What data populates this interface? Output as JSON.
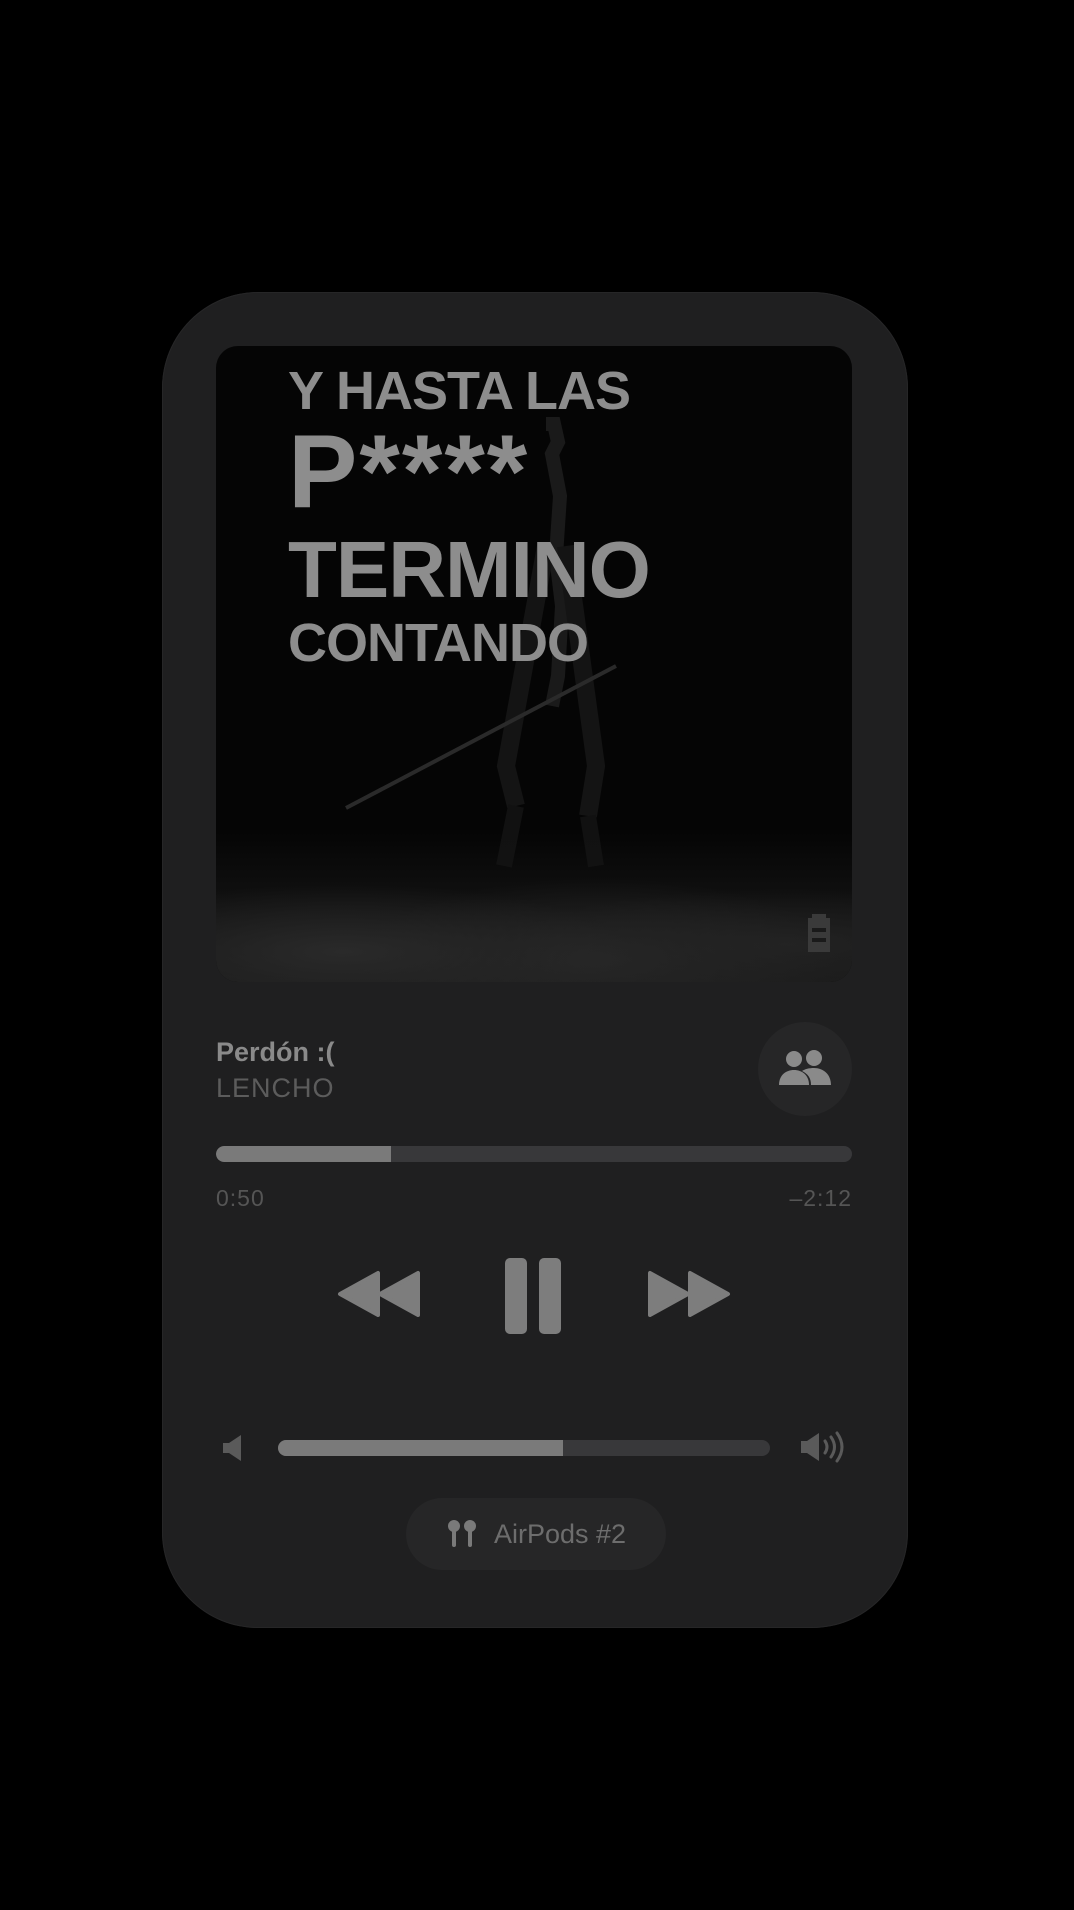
{
  "artwork": {
    "line1": "Y HASTA LAS",
    "line2": "P****",
    "line3": "TERMINO",
    "line4": "CONTANDO"
  },
  "track": {
    "title": "Perdón :(",
    "artist": "LENCHO"
  },
  "playback": {
    "elapsed": "0:50",
    "remaining": "–2:12",
    "progress_fraction": 0.275
  },
  "volume": {
    "level_fraction": 0.58
  },
  "output_device": {
    "label": "AirPods #2",
    "icon": "airpods-icon"
  },
  "icons": {
    "shareplay": "shareplay-people-icon",
    "rewind": "rewind-icon",
    "pause": "pause-icon",
    "forward": "fast-forward-icon",
    "volume_low": "speaker-low-icon",
    "volume_high": "speaker-high-icon"
  },
  "colors": {
    "background": "#000000",
    "card": "#1f1f20",
    "foreground": "#8d8d8d",
    "track": "#38383a"
  }
}
